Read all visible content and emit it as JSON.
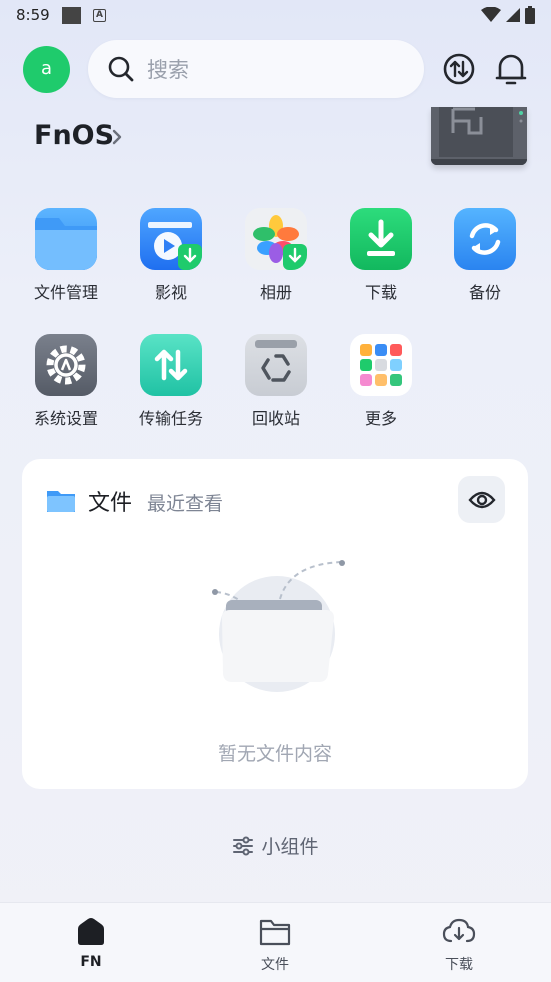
{
  "status_bar": {
    "time": "8:59",
    "notif_letter": "A"
  },
  "header": {
    "avatar_letter": "a",
    "search_placeholder": "搜索",
    "icons": [
      "search-icon",
      "transfer-icon",
      "bell-icon"
    ]
  },
  "device": {
    "name": "FnOS"
  },
  "apps": [
    {
      "label": "文件管理",
      "icon": "folder-icon"
    },
    {
      "label": "影视",
      "icon": "video-icon"
    },
    {
      "label": "相册",
      "icon": "photos-icon"
    },
    {
      "label": "下载",
      "icon": "download-icon"
    },
    {
      "label": "备份",
      "icon": "backup-icon"
    },
    {
      "label": "系统设置",
      "icon": "settings-icon"
    },
    {
      "label": "传输任务",
      "icon": "transfer-tasks-icon"
    },
    {
      "label": "回收站",
      "icon": "recycle-bin-icon"
    },
    {
      "label": "更多",
      "icon": "more-apps-icon"
    }
  ],
  "files_card": {
    "title": "文件",
    "subtitle": "最近查看",
    "empty_text": "暂无文件内容"
  },
  "widget_label": "小组件",
  "bottom_nav": [
    {
      "label": "FN",
      "icon": "home-icon",
      "active": true
    },
    {
      "label": "文件",
      "icon": "folder-outline-icon",
      "active": false
    },
    {
      "label": "下载",
      "icon": "cloud-download-icon",
      "active": false
    }
  ],
  "colors": {
    "avatar": "#1fcb6c",
    "accent_blue": "#2f8cf1",
    "accent_green": "#1fcb6c"
  }
}
